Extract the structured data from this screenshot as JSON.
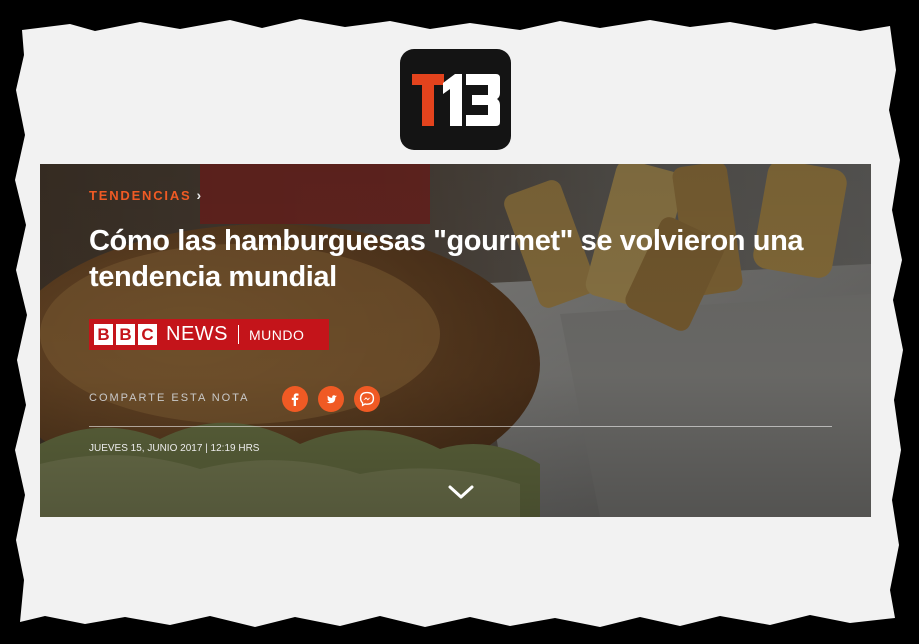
{
  "logo": {
    "text": "T13"
  },
  "article": {
    "section": "TENDENCIAS",
    "section_chevron": "›",
    "headline": "Cómo las hamburguesas \"gourmet\" se volvieron una tendencia mundial",
    "source": {
      "letters": [
        "B",
        "B",
        "C"
      ],
      "brand": "NEWS",
      "edition": "MUNDO"
    },
    "share": {
      "label": "COMPARTE ESTA NOTA",
      "buttons": [
        "facebook-icon",
        "twitter-icon",
        "messenger-icon"
      ]
    },
    "dateline": "JUEVES 15, JUNIO 2017 | 12:19 HRS"
  },
  "colors": {
    "accent": "#f05a24",
    "bbc_red": "#c4141a",
    "logo_bg": "#141414",
    "logo_red": "#e3431d",
    "paper": "#f2f2f2",
    "text_white": "#ffffff"
  }
}
